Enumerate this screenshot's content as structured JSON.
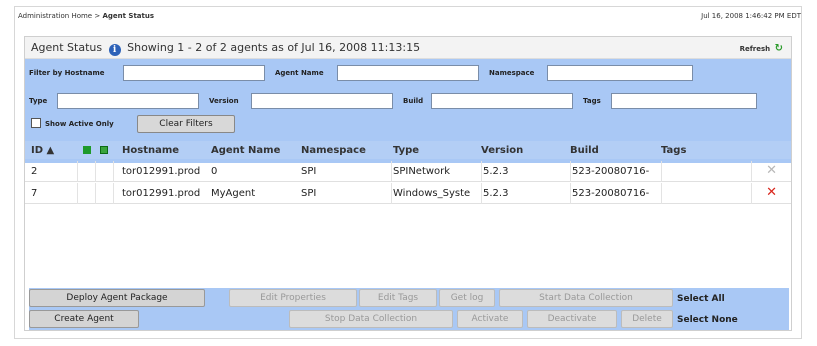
{
  "breadcrumb": {
    "home": "Administration Home",
    "separator": ">",
    "current": "Agent Status"
  },
  "timestamp": "Jul 16, 2008 1:46:42 PM EDT",
  "panel": {
    "title": "Agent Status",
    "showing": "Showing 1 - 2  of 2 agents as of Jul 16, 2008 11:13:15",
    "refresh_label": "Refresh",
    "refresh_icon": "refresh-arrows-icon"
  },
  "filters": {
    "hostname_label": "Filter by Hostname",
    "agent_name_label": "Agent Name",
    "namespace_label": "Namespace",
    "type_label": "Type",
    "version_label": "Version",
    "build_label": "Build",
    "tags_label": "Tags",
    "hostname_value": "",
    "agent_name_value": "",
    "namespace_value": "",
    "type_value": "",
    "version_value": "",
    "build_value": "",
    "tags_value": "",
    "show_active_only_label": "Show Active Only",
    "show_active_only_checked": false,
    "clear_filters_label": "Clear Filters"
  },
  "table": {
    "headers": {
      "id": "ID ▲",
      "hostname": "Hostname",
      "agent_name": "Agent Name",
      "namespace": "Namespace",
      "type": "Type",
      "version": "Version",
      "build": "Build",
      "tags": "Tags"
    },
    "status_colors": {
      "active": "#1f9a2a",
      "border": "#0d6b16"
    },
    "rows": [
      {
        "id": "2",
        "hostname": "tor012991.prod",
        "agent_name": "0",
        "namespace": "SPI",
        "type": "SPINetwork",
        "version": "5.2.3",
        "build": "523-20080716-",
        "tags": "",
        "delete_icon": "delete-x-icon-disabled",
        "delete_color": "#b8b8b8"
      },
      {
        "id": "7",
        "hostname": "tor012991.prod",
        "agent_name": "MyAgent",
        "namespace": "SPI",
        "type": "Windows_Syste",
        "version": "5.2.3",
        "build": "523-20080716-",
        "tags": "",
        "delete_icon": "delete-x-icon",
        "delete_color": "#d9261c"
      }
    ]
  },
  "actions": {
    "deploy_agent_package": "Deploy Agent Package",
    "create_agent": "Create Agent",
    "edit_properties": "Edit Properties",
    "edit_tags": "Edit Tags",
    "get_log": "Get log",
    "start_data_collection": "Start Data Collection",
    "stop_data_collection": "Stop Data Collection",
    "activate": "Activate",
    "deactivate": "Deactivate",
    "delete": "Delete",
    "select_all": "Select All",
    "select_none": "Select None"
  }
}
